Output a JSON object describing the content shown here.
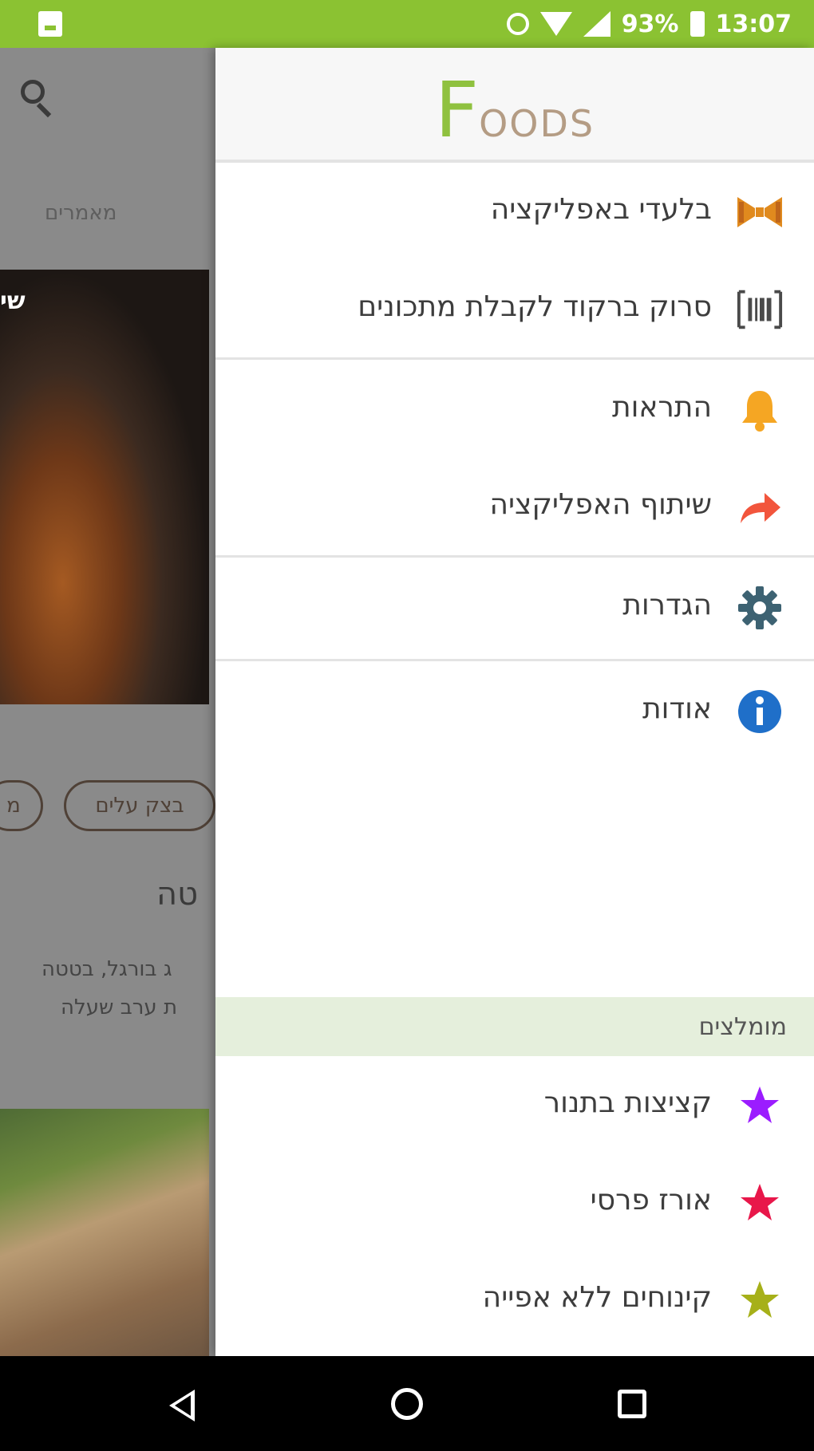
{
  "status_bar": {
    "battery_text": "93%",
    "time": "13:07"
  },
  "background_app": {
    "tab_label": "מאמרים",
    "photo_label": "שי",
    "chips": [
      "מ",
      "בצק עלים"
    ],
    "title": "טה",
    "description_lines": [
      "ג בורגל, בטטה",
      "ת ערב שעלה"
    ]
  },
  "drawer": {
    "logo_initial": "F",
    "logo_rest": "oods",
    "menu_items": [
      {
        "label": "בלעדי באפליקציה",
        "icon": "bowtie-icon",
        "color": "#e08a1e"
      },
      {
        "label": "סרוק ברקוד לקבלת מתכונים",
        "icon": "barcode-scan-icon",
        "color": "#4a4a4a"
      },
      {
        "label": "התראות",
        "icon": "bell-icon",
        "color": "#f5a623"
      },
      {
        "label": "שיתוף האפליקציה",
        "icon": "share-arrow-icon",
        "color": "#f2553c"
      },
      {
        "label": "הגדרות",
        "icon": "gear-icon",
        "color": "#3d6272"
      },
      {
        "label": "אודות",
        "icon": "info-icon",
        "color": "#1f6fc9"
      }
    ],
    "recommended_header": "מומלצים",
    "recommended_items": [
      {
        "label": "קציצות בתנור",
        "icon": "star-icon",
        "color": "#9b1cff"
      },
      {
        "label": "אורז פרסי",
        "icon": "star-icon",
        "color": "#e8174a"
      },
      {
        "label": "קינוחים ללא אפייה",
        "icon": "star-icon",
        "color": "#a6b019"
      }
    ]
  },
  "colors": {
    "status_bar": "#8bc232",
    "logo_green": "#8fc13f",
    "logo_brown": "#b49c84",
    "section_bg": "#e5efdc"
  }
}
